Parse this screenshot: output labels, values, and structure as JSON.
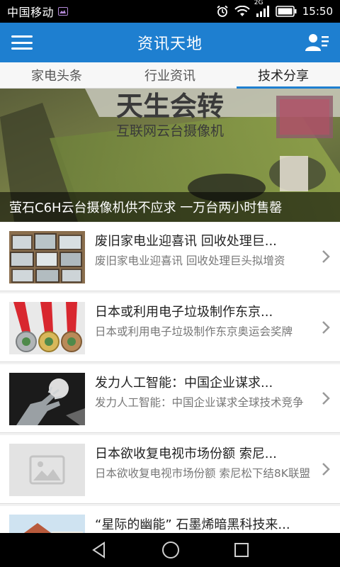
{
  "status_bar": {
    "carrier": "中国移动",
    "network": "2G",
    "time": "15:50"
  },
  "header": {
    "title": "资讯天地"
  },
  "tabs": [
    {
      "label": "家电头条",
      "active": false
    },
    {
      "label": "行业资讯",
      "active": false
    },
    {
      "label": "技术分享",
      "active": true
    }
  ],
  "banner": {
    "image_title": "天生会转",
    "image_subtitle": "互联网云台摄像机",
    "caption": "萤石C6H云台摄像机供不应求 一万台两小时售罄"
  },
  "news": [
    {
      "title": "废旧家电业迎喜讯 回收处理巨...",
      "desc": "废旧家电业迎喜讯 回收处理巨头拟增资",
      "thumb": "tv-stack"
    },
    {
      "title": "日本或利用电子垃圾制作东京...",
      "desc": "日本或利用电子垃圾制作东京奥运会奖牌",
      "thumb": "medals"
    },
    {
      "title": "发力人工智能：中国企业谋求...",
      "desc": "发力人工智能：中国企业谋求全球技术竞争",
      "thumb": "robot-hand"
    },
    {
      "title": "日本欲收复电视市场份额 索尼...",
      "desc": "日本欲收复电视市场份额 索尼松下结8K联盟",
      "thumb": "placeholder"
    },
    {
      "title": "“星际的幽能” 石墨烯暗黑科技来...",
      "desc": "",
      "thumb": "house"
    }
  ],
  "colors": {
    "primary": "#1e7fd0",
    "title_text": "#222222",
    "desc_text": "#777777"
  }
}
